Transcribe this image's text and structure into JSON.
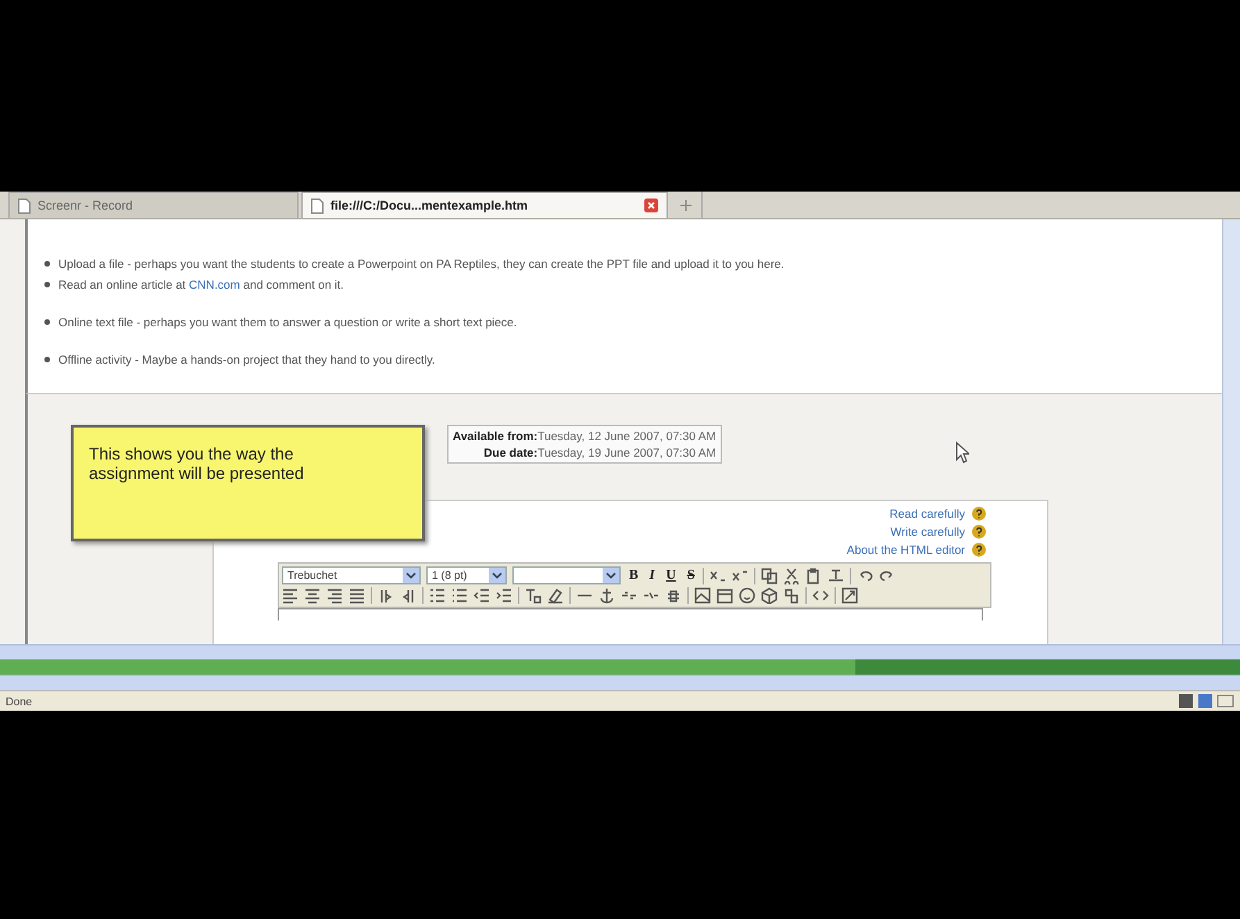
{
  "tabs": [
    {
      "label": "Screenr - Record",
      "selected": false
    },
    {
      "label": "file:///C:/Docu...mentexample.htm",
      "selected": true
    }
  ],
  "options": [
    {
      "text": "Upload a file - perhaps you want the students to create a Powerpoint on PA Reptiles, they can create the PPT file and upload it to you here."
    },
    {
      "text": "Read an online article at ",
      "link": "CNN.com",
      "text_after": " and comment on it."
    },
    {
      "text": "Online text file - perhaps you want them to answer a question or write a short text piece."
    },
    {
      "text": "Offline activity - Maybe a hands-on project that they hand to you directly."
    }
  ],
  "callout": {
    "text": "This shows you the way the assignment will be presented"
  },
  "dates": [
    {
      "label": "Available from:",
      "value": "Tuesday, 12 June 2007, 07:30 AM"
    },
    {
      "label": "Due date:",
      "value": "Tuesday, 19 June 2007, 07:30 AM"
    }
  ],
  "help_links": [
    "Read carefully",
    "Write carefully",
    "About the HTML editor"
  ],
  "editor": {
    "font": "Trebuchet",
    "size": "1 (8 pt)",
    "format_buttons": [
      "B",
      "I",
      "U",
      "S"
    ]
  },
  "video_progress": {
    "level": 0.69
  },
  "status_bar": {
    "text": "Done"
  }
}
